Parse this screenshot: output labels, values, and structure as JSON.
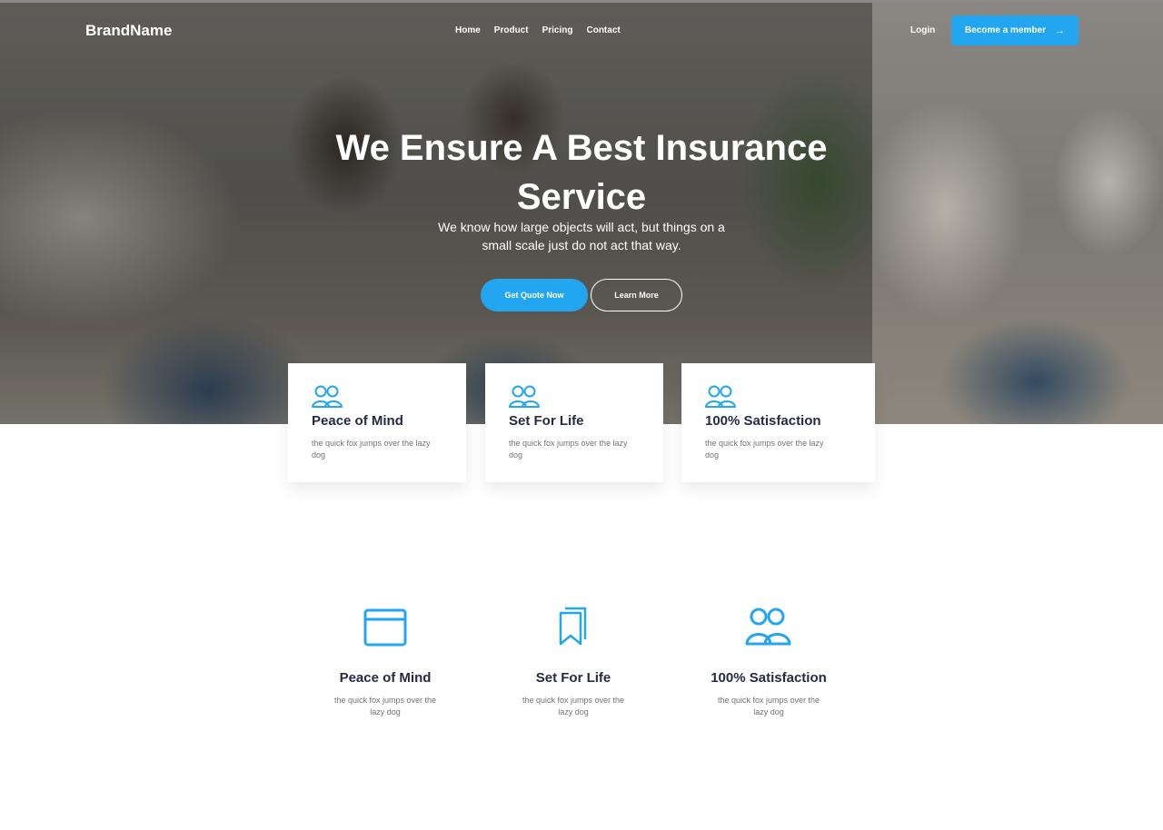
{
  "nav": {
    "brand": "BrandName",
    "links": [
      "Home",
      "Product",
      "Pricing",
      "Contact"
    ],
    "login": "Login",
    "cta": "Become a member"
  },
  "hero": {
    "title": "We Ensure A Best Insurance Service",
    "subtitle": "We know how large objects will act, but things on a small scale just do not act that way.",
    "primary_button": "Get Quote Now",
    "secondary_button": "Learn More"
  },
  "cards": [
    {
      "icon": "users-icon",
      "title": "Peace of Mind",
      "desc": "the quick fox jumps over the lazy dog"
    },
    {
      "icon": "users-icon",
      "title": "Set For Life",
      "desc": "the quick fox jumps over the lazy dog"
    },
    {
      "icon": "users-icon",
      "title": "100% Satisfaction",
      "desc": "the quick fox jumps over the lazy dog"
    }
  ],
  "features": [
    {
      "icon": "browser-window-icon",
      "title": "Peace of Mind",
      "desc": "the quick fox jumps over the lazy dog"
    },
    {
      "icon": "bookmarks-icon",
      "title": "Set For Life",
      "desc": "the quick fox jumps over the lazy dog"
    },
    {
      "icon": "users-icon",
      "title": "100% Satisfaction",
      "desc": "the quick fox jumps over the lazy dog"
    }
  ],
  "colors": {
    "accent": "#23a6f0",
    "heading": "#252b42",
    "muted": "#737373"
  }
}
